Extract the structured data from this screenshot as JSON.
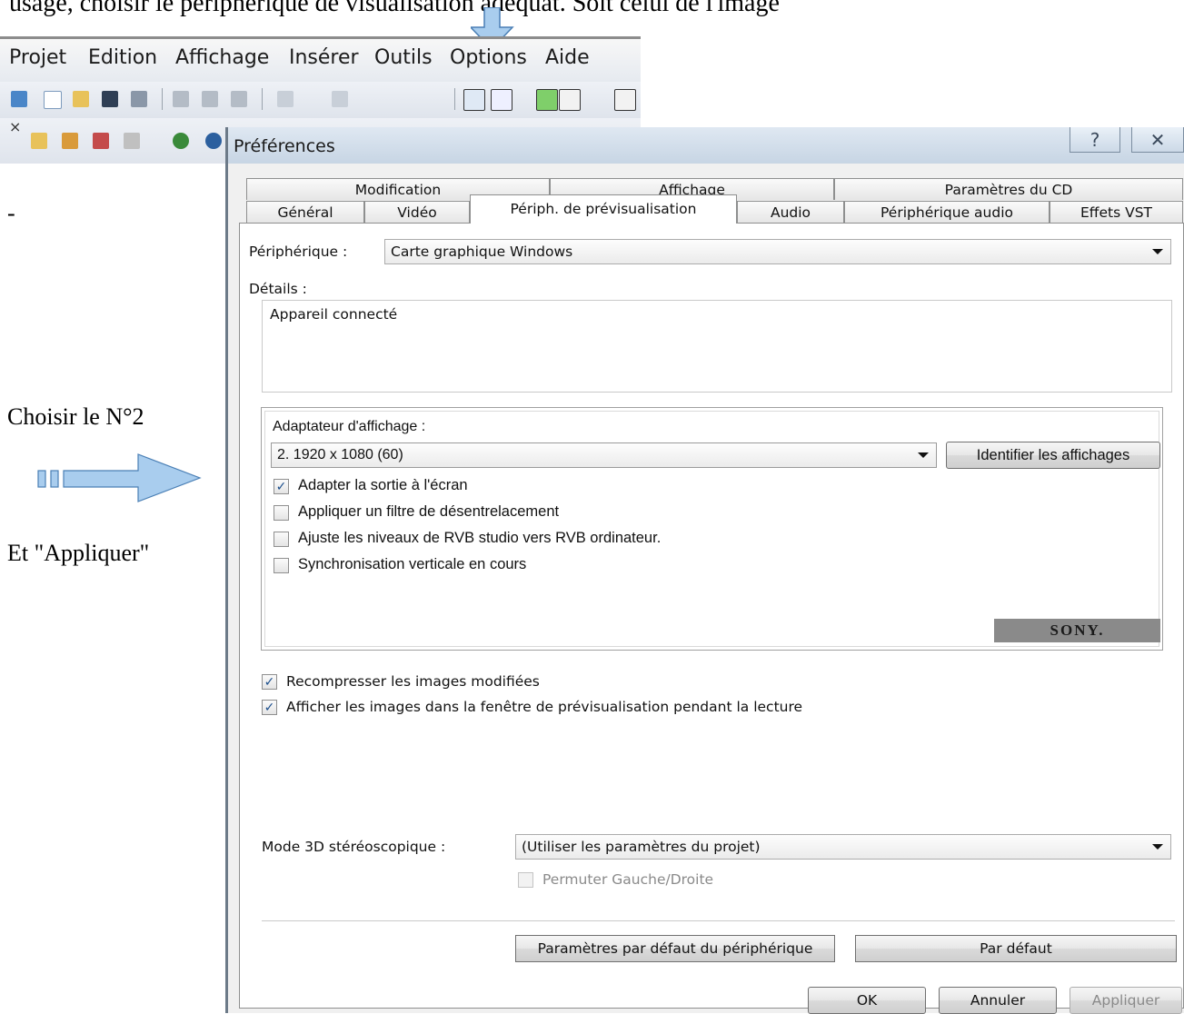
{
  "doc": {
    "top_partial_text": "usage, choisir le périphérique de visualisation adéquat. Soit celui de l'image",
    "dash": "-",
    "choose_text": "Choisir le N°2",
    "apply_text": "Et \"Appliquer\""
  },
  "app": {
    "menu": [
      "Projet",
      "Edition",
      "Affichage",
      "Insérer",
      "Outils",
      "Options",
      "Aide"
    ],
    "close_mark": "×"
  },
  "dialog": {
    "title": "Préférences",
    "help_glyph": "?",
    "close_glyph": "✕",
    "tabs_row1": [
      "Modification",
      "Affichage",
      "Paramètres du CD"
    ],
    "tabs_row2": [
      "Général",
      "Vidéo",
      "Périph. de prévisualisation",
      "Audio",
      "Périphérique audio",
      "Effets VST"
    ],
    "active_tab": "Périph. de prévisualisation",
    "device_label": "Périphérique :",
    "device_value": "Carte graphique Windows",
    "details_label": "Détails :",
    "details_text": "Appareil connecté",
    "adapter_label": "Adaptateur d'affichage :",
    "adapter_value": "2. 1920 x 1080 (60)",
    "identify_button": "Identifier les affichages",
    "group_options": [
      {
        "label": "Adapter la sortie à l'écran",
        "checked": true
      },
      {
        "label": "Appliquer un filtre de désentrelacement",
        "checked": false
      },
      {
        "label": "Ajuste les niveaux de RVB studio vers RVB ordinateur.",
        "checked": false
      },
      {
        "label": "Synchronisation verticale en cours",
        "checked": false
      }
    ],
    "sony_logo": "SONY.",
    "recompress_label": "Recompresser les images modifiées",
    "show_frames_label": "Afficher les images dans la fenêtre de prévisualisation pendant la lecture",
    "stereo_label": "Mode 3D stéréoscopique :",
    "stereo_value": "(Utiliser les paramètres du projet)",
    "swap_label": "Permuter Gauche/Droite",
    "device_defaults_button": "Paramètres par défaut du périphérique",
    "defaults_button": "Par défaut",
    "ok_button": "OK",
    "cancel_button": "Annuler",
    "apply_button": "Appliquer",
    "check_glyph": "✓"
  },
  "colors": {
    "arrow_fill": "#a9cdee",
    "arrow_stroke": "#4a7fb5"
  }
}
